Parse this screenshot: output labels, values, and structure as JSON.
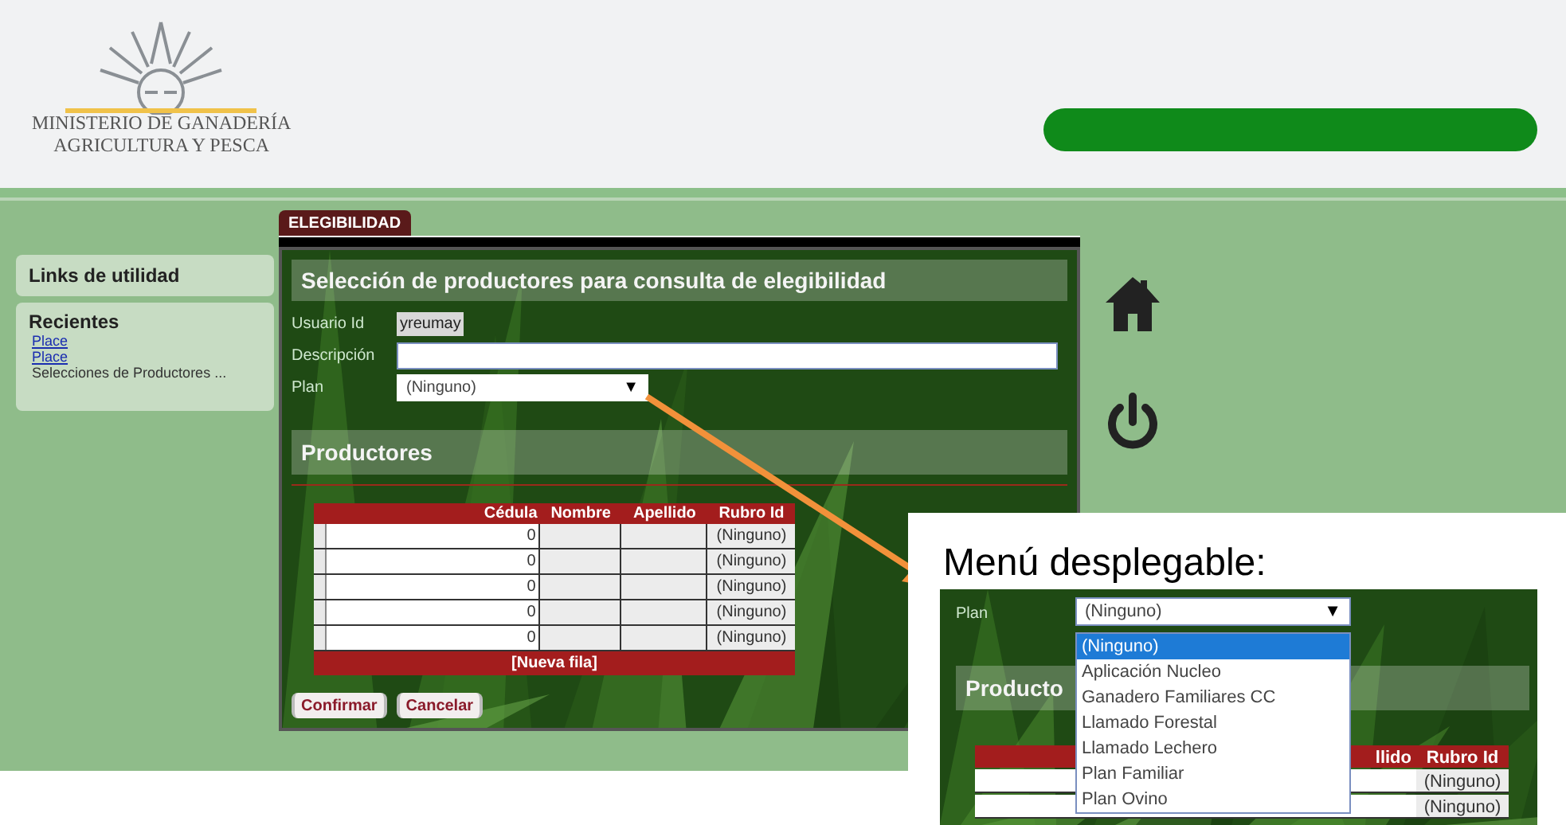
{
  "header": {
    "ministry_line_1": "MINISTERIO DE GANADERÍA",
    "ministry_line_2": "AGRICULTURA Y PESCA"
  },
  "sidebar": {
    "links_heading": "Links de utilidad",
    "recent_heading": "Recientes",
    "recent_items": [
      {
        "label": "Place",
        "kind": "link"
      },
      {
        "label": "Place",
        "kind": "link"
      },
      {
        "label": "Selecciones de Productores ...",
        "kind": "text"
      }
    ]
  },
  "tabs": [
    {
      "label": "ELEGIBILIDAD",
      "selected": true
    }
  ],
  "form": {
    "title": "Selección de productores para consulta de elegibilidad",
    "fields": [
      {
        "kind": "readonly",
        "label": "Usuario Id",
        "value": "yreumay"
      },
      {
        "kind": "text",
        "label": "Descripción"
      },
      {
        "kind": "select",
        "label": "Plan",
        "value": "(Ninguno)",
        "arrow": "▼"
      }
    ]
  },
  "productores": {
    "title": "Productores",
    "columns": [
      "Cédula",
      "Nombre",
      "Apellido",
      "Rubro Id"
    ],
    "rows": [
      {
        "cedula": "0",
        "rubro_id": "(Ninguno)"
      },
      {
        "cedula": "0",
        "rubro_id": "(Ninguno)"
      },
      {
        "cedula": "0",
        "rubro_id": "(Ninguno)"
      },
      {
        "cedula": "0",
        "rubro_id": "(Ninguno)"
      },
      {
        "cedula": "0",
        "rubro_id": "(Ninguno)"
      }
    ],
    "add_row": "[Nueva fila]"
  },
  "buttons": [
    "Confirmar",
    "Cancelar"
  ],
  "callout": {
    "caption": "Menú desplegable:",
    "plan_label": "Plan",
    "select_value": "(Ninguno)",
    "arrow": "▼",
    "options": [
      {
        "label": "(Ninguno)",
        "selected": true
      },
      {
        "label": "Aplicación Nucleo",
        "selected": false
      },
      {
        "label": "Ganadero Familiares CC",
        "selected": false
      },
      {
        "label": "Llamado Forestal",
        "selected": false
      },
      {
        "label": "Llamado Lechero",
        "selected": false
      },
      {
        "label": "Plan Familiar",
        "selected": false
      },
      {
        "label": "Plan Ovino",
        "selected": false
      }
    ],
    "section_title": "Producto",
    "columns": [
      "llido",
      "Rubro Id"
    ],
    "rows": [
      "(Ninguno)",
      "(Ninguno)"
    ]
  }
}
